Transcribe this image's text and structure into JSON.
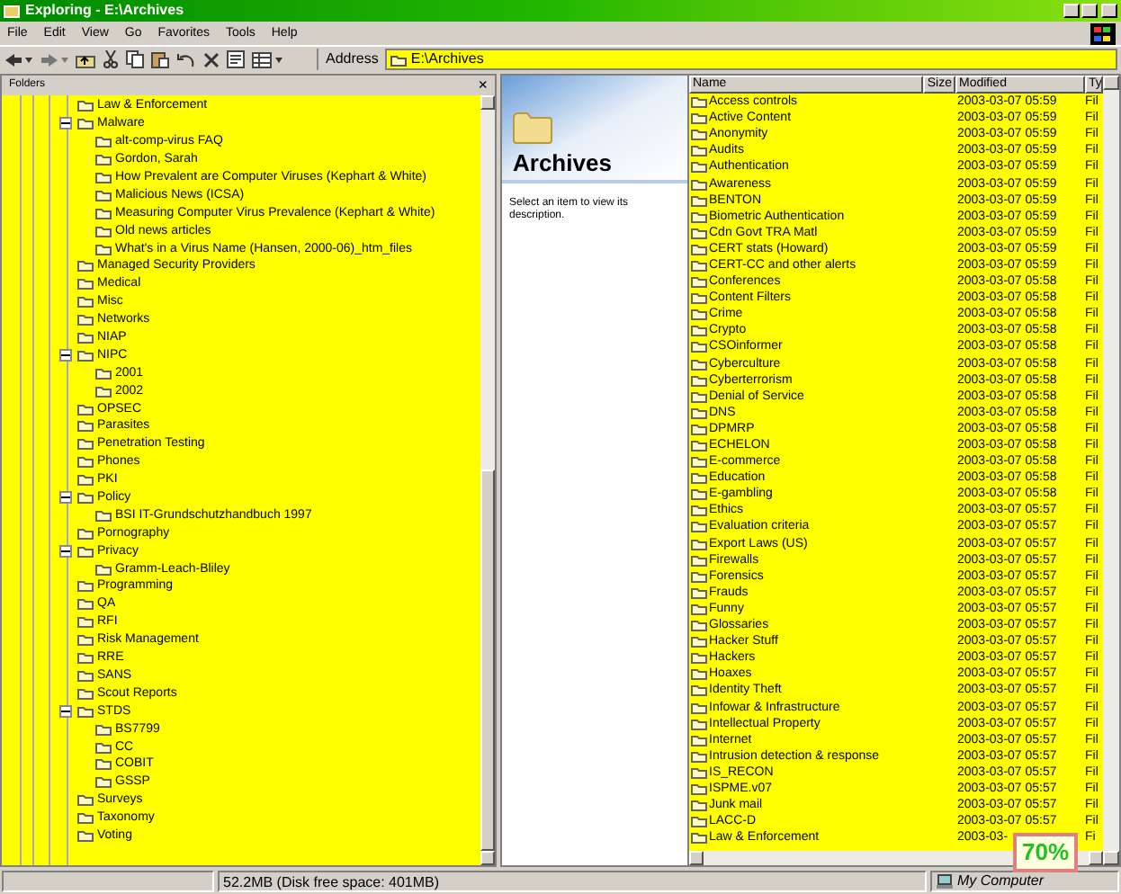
{
  "window": {
    "title": "Exploring - E:\\Archives"
  },
  "menu": [
    "File",
    "Edit",
    "View",
    "Go",
    "Favorites",
    "Tools",
    "Help"
  ],
  "address": {
    "label": "Address",
    "value": "E:\\Archives"
  },
  "folders_pane": {
    "title": "Folders",
    "close": "×",
    "tree": [
      {
        "label": "Law & Enforcement"
      },
      {
        "label": "Malware",
        "expanded": true,
        "children": [
          {
            "label": "alt-comp-virus FAQ"
          },
          {
            "label": "Gordon, Sarah"
          },
          {
            "label": "How Prevalent are Computer Viruses (Kephart & White)"
          },
          {
            "label": "Malicious News (ICSA)"
          },
          {
            "label": "Measuring Computer Virus Prevalence (Kephart & White)"
          },
          {
            "label": "Old news articles"
          },
          {
            "label": "What's in a Virus Name (Hansen, 2000-06)_htm_files"
          }
        ]
      },
      {
        "label": "Managed Security Providers"
      },
      {
        "label": "Medical"
      },
      {
        "label": "Misc"
      },
      {
        "label": "Networks"
      },
      {
        "label": "NIAP"
      },
      {
        "label": "NIPC",
        "expanded": true,
        "children": [
          {
            "label": "2001"
          },
          {
            "label": "2002"
          }
        ]
      },
      {
        "label": "OPSEC"
      },
      {
        "label": "Parasites"
      },
      {
        "label": "Penetration Testing"
      },
      {
        "label": "Phones"
      },
      {
        "label": "PKI"
      },
      {
        "label": "Policy",
        "expanded": true,
        "children": [
          {
            "label": "BSI IT-Grundschutzhandbuch 1997"
          }
        ]
      },
      {
        "label": "Pornography"
      },
      {
        "label": "Privacy",
        "expanded": true,
        "children": [
          {
            "label": "Gramm-Leach-Bliley"
          }
        ]
      },
      {
        "label": "Programming"
      },
      {
        "label": "QA"
      },
      {
        "label": "RFI"
      },
      {
        "label": "Risk Management"
      },
      {
        "label": "RRE"
      },
      {
        "label": "SANS"
      },
      {
        "label": "Scout Reports"
      },
      {
        "label": "STDS",
        "expanded": true,
        "children": [
          {
            "label": "BS7799"
          },
          {
            "label": "CC"
          },
          {
            "label": "COBIT"
          },
          {
            "label": "GSSP"
          }
        ]
      },
      {
        "label": "Surveys"
      },
      {
        "label": "Taxonomy"
      },
      {
        "label": "Voting"
      }
    ]
  },
  "web_view": {
    "title": "Archives",
    "description": "Select an item to view its description."
  },
  "file_list": {
    "columns": [
      "Name",
      "Size",
      "Modified",
      "Ty"
    ],
    "rows": [
      [
        "Access controls",
        "",
        "2003-03-07 05:59",
        "Fil"
      ],
      [
        "Active Content",
        "",
        "2003-03-07 05:59",
        "Fil"
      ],
      [
        "Anonymity",
        "",
        "2003-03-07 05:59",
        "Fil"
      ],
      [
        "Audits",
        "",
        "2003-03-07 05:59",
        "Fil"
      ],
      [
        "Authentication",
        "",
        "2003-03-07 05:59",
        "Fil"
      ],
      [
        "Awareness",
        "",
        "2003-03-07 05:59",
        "Fil"
      ],
      [
        "BENTON",
        "",
        "2003-03-07 05:59",
        "Fil"
      ],
      [
        "Biometric Authentication",
        "",
        "2003-03-07 05:59",
        "Fil"
      ],
      [
        "Cdn Govt TRA Matl",
        "",
        "2003-03-07 05:59",
        "Fil"
      ],
      [
        "CERT stats (Howard)",
        "",
        "2003-03-07 05:59",
        "Fil"
      ],
      [
        "CERT-CC and other alerts",
        "",
        "2003-03-07 05:59",
        "Fil"
      ],
      [
        "Conferences",
        "",
        "2003-03-07 05:58",
        "Fil"
      ],
      [
        "Content Filters",
        "",
        "2003-03-07 05:58",
        "Fil"
      ],
      [
        "Crime",
        "",
        "2003-03-07 05:58",
        "Fil"
      ],
      [
        "Crypto",
        "",
        "2003-03-07 05:58",
        "Fil"
      ],
      [
        "CSOinformer",
        "",
        "2003-03-07 05:58",
        "Fil"
      ],
      [
        "Cyberculture",
        "",
        "2003-03-07 05:58",
        "Fil"
      ],
      [
        "Cyberterrorism",
        "",
        "2003-03-07 05:58",
        "Fil"
      ],
      [
        "Denial of Service",
        "",
        "2003-03-07 05:58",
        "Fil"
      ],
      [
        "DNS",
        "",
        "2003-03-07 05:58",
        "Fil"
      ],
      [
        "DPMRP",
        "",
        "2003-03-07 05:58",
        "Fil"
      ],
      [
        "ECHELON",
        "",
        "2003-03-07 05:58",
        "Fil"
      ],
      [
        "E-commerce",
        "",
        "2003-03-07 05:58",
        "Fil"
      ],
      [
        "Education",
        "",
        "2003-03-07 05:58",
        "Fil"
      ],
      [
        "E-gambling",
        "",
        "2003-03-07 05:58",
        "Fil"
      ],
      [
        "Ethics",
        "",
        "2003-03-07 05:57",
        "Fil"
      ],
      [
        "Evaluation criteria",
        "",
        "2003-03-07 05:57",
        "Fil"
      ],
      [
        "Export Laws (US)",
        "",
        "2003-03-07 05:57",
        "Fil"
      ],
      [
        "Firewalls",
        "",
        "2003-03-07 05:57",
        "Fil"
      ],
      [
        "Forensics",
        "",
        "2003-03-07 05:57",
        "Fil"
      ],
      [
        "Frauds",
        "",
        "2003-03-07 05:57",
        "Fil"
      ],
      [
        "Funny",
        "",
        "2003-03-07 05:57",
        "Fil"
      ],
      [
        "Glossaries",
        "",
        "2003-03-07 05:57",
        "Fil"
      ],
      [
        "Hacker Stuff",
        "",
        "2003-03-07 05:57",
        "Fil"
      ],
      [
        "Hackers",
        "",
        "2003-03-07 05:57",
        "Fil"
      ],
      [
        "Hoaxes",
        "",
        "2003-03-07 05:57",
        "Fil"
      ],
      [
        "Identity Theft",
        "",
        "2003-03-07 05:57",
        "Fil"
      ],
      [
        "Infowar & Infrastructure",
        "",
        "2003-03-07 05:57",
        "Fil"
      ],
      [
        "Intellectual Property",
        "",
        "2003-03-07 05:57",
        "Fil"
      ],
      [
        "Internet",
        "",
        "2003-03-07 05:57",
        "Fil"
      ],
      [
        "Intrusion detection & response",
        "",
        "2003-03-07 05:57",
        "Fil"
      ],
      [
        "IS_RECON",
        "",
        "2003-03-07 05:57",
        "Fil"
      ],
      [
        "ISPME.v07",
        "",
        "2003-03-07 05:57",
        "Fil"
      ],
      [
        "Junk mail",
        "",
        "2003-03-07 05:57",
        "Fil"
      ],
      [
        "LACC-D",
        "",
        "2003-03-07 05:57",
        "Fil"
      ],
      [
        "Law & Enforcement",
        "",
        "2003-03-",
        "Fi"
      ]
    ]
  },
  "zoom_badge": "70%",
  "status_bar": [
    "52.2MB (Disk free space: 401MB)",
    "My Computer"
  ]
}
